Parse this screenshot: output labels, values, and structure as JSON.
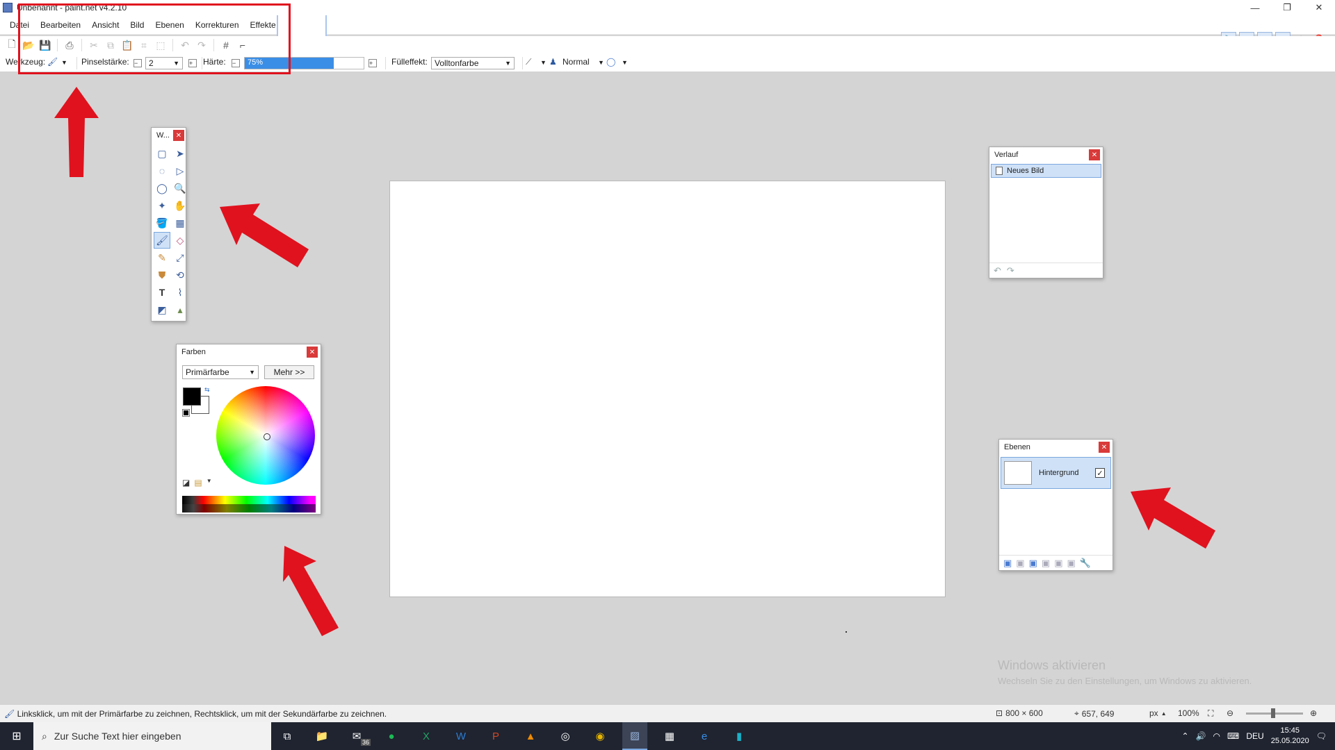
{
  "window": {
    "title": "Unbenannt - paint.net v4.2.10",
    "minimize_icon": "minimize-icon",
    "restore_icon": "restore-icon",
    "close_icon": "close-icon"
  },
  "menu": {
    "items": [
      "Datei",
      "Bearbeiten",
      "Ansicht",
      "Bild",
      "Ebenen",
      "Korrekturen",
      "Effekte"
    ]
  },
  "toolbar_options": {
    "tool_label": "Werkzeug:",
    "brush_width_label": "Pinselstärke:",
    "brush_width_value": "2",
    "hardness_label": "Härte:",
    "hardness_value": "75%",
    "hardness_fraction": 0.75,
    "fill_label": "Fülleffekt:",
    "fill_value": "Volltonfarbe",
    "blend_mode": "Normal"
  },
  "tools_panel": {
    "title": "W..."
  },
  "colors_panel": {
    "title": "Farben",
    "mode_select": "Primärfarbe",
    "more_button": "Mehr >>",
    "primary_color": "#000000",
    "secondary_color": "#ffffff"
  },
  "history_panel": {
    "title": "Verlauf",
    "items": [
      "Neues Bild"
    ]
  },
  "layers_panel": {
    "title": "Ebenen",
    "layers": [
      {
        "name": "Hintergrund",
        "visible": true
      }
    ]
  },
  "watermark": {
    "title": "Windows aktivieren",
    "subtitle": "Wechseln Sie zu den Einstellungen, um Windows zu aktivieren."
  },
  "status": {
    "hint": "Linksklick, um mit der Primärfarbe zu zeichnen, Rechtsklick, um mit der Sekundärfarbe zu zeichnen.",
    "image_size": "800 × 600",
    "cursor_pos": "657, 649",
    "unit": "px",
    "zoom": "100%"
  },
  "taskbar": {
    "search_placeholder": "Zur Suche Text hier eingeben",
    "mail_badge": "36",
    "language": "DEU",
    "time": "15:45",
    "date": "25.05.2020"
  },
  "colors": {
    "annotation_red": "#e0121e",
    "selection_blue": "#cfe1f7",
    "accent_blue": "#3b8ee6"
  }
}
